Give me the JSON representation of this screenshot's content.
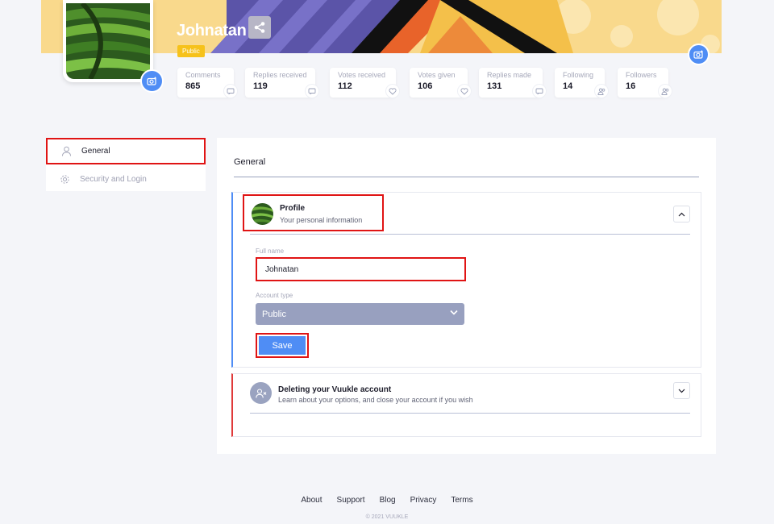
{
  "header": {
    "user_name": "Johnatan",
    "visibility_badge": "Public"
  },
  "stats": [
    {
      "label": "Comments",
      "value": "865",
      "icon": "comment-icon"
    },
    {
      "label": "Replies received",
      "value": "119",
      "icon": "reply-icon"
    },
    {
      "label": "Votes received",
      "value": "112",
      "icon": "heart-plus-icon"
    },
    {
      "label": "Votes given",
      "value": "106",
      "icon": "heart-plus-icon"
    },
    {
      "label": "Replies made",
      "value": "131",
      "icon": "reply-icon"
    },
    {
      "label": "Following",
      "value": "14",
      "icon": "users-icon"
    },
    {
      "label": "Followers",
      "value": "16",
      "icon": "users-icon"
    }
  ],
  "sidebar": {
    "items": [
      {
        "label": "General",
        "icon": "user-icon"
      },
      {
        "label": "Security and Login",
        "icon": "gear-icon"
      }
    ]
  },
  "main": {
    "title": "General",
    "profile_card": {
      "title": "Profile",
      "subtitle": "Your personal information",
      "full_name_label": "Full name",
      "full_name_value": "Johnatan",
      "account_type_label": "Account type",
      "account_type_value": "Public",
      "save_label": "Save"
    },
    "delete_card": {
      "title": "Deleting your Vuukle account",
      "subtitle": "Learn about your options, and close your account if you wish"
    }
  },
  "footer": {
    "links": [
      "About",
      "Support",
      "Blog",
      "Privacy",
      "Terms"
    ],
    "copyright": "© 2021 VUUKLE"
  },
  "colors": {
    "accent": "#4f8df5",
    "badge": "#f6c21b",
    "danger": "#e03a3a",
    "select_bg": "#98a0bf"
  }
}
